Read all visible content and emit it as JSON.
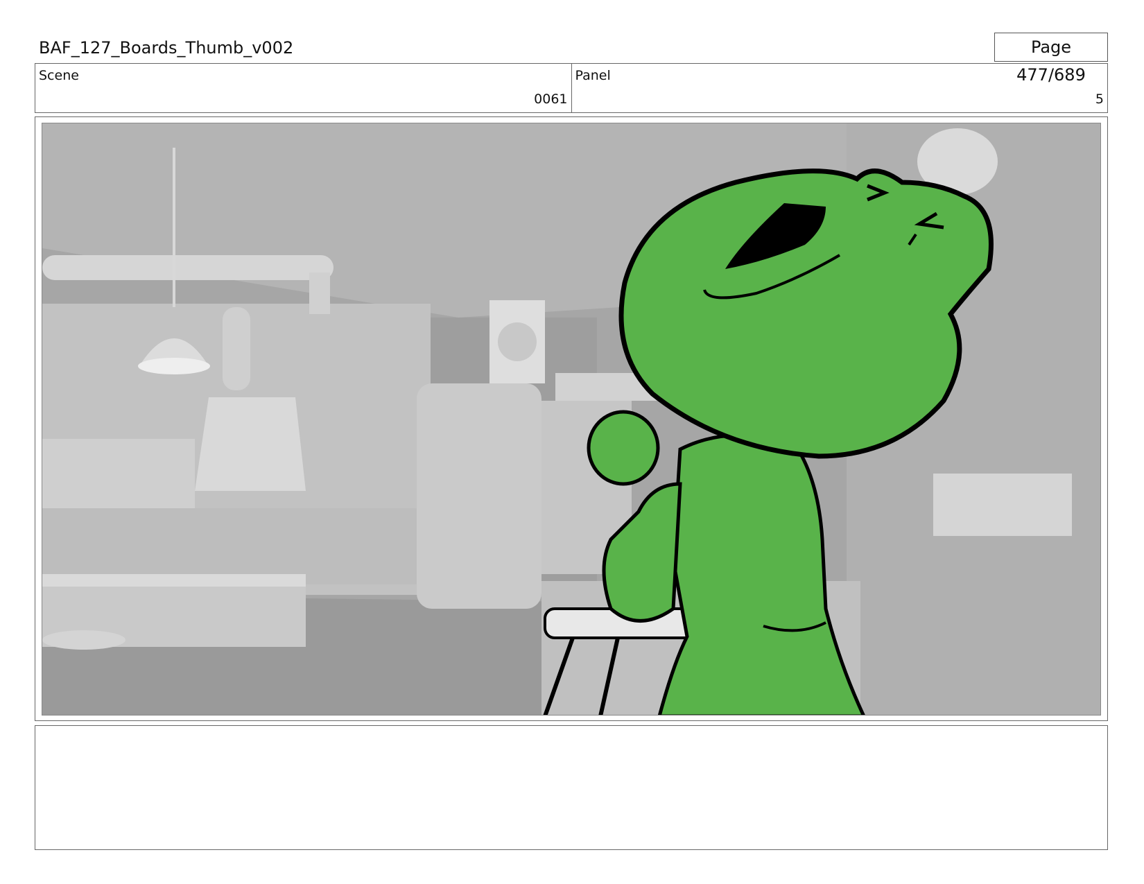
{
  "header": {
    "title": "BAF_127_Boards_Thumb_v002",
    "page": "Page 477/689"
  },
  "scene": {
    "label": "Scene",
    "value": "0061"
  },
  "panel": {
    "label": "Panel",
    "value": "5"
  },
  "frame": {
    "background_color": "#a6a6a6",
    "character_color": "#59b34a",
    "outline_color": "#000000"
  },
  "notes": {
    "text": ""
  }
}
